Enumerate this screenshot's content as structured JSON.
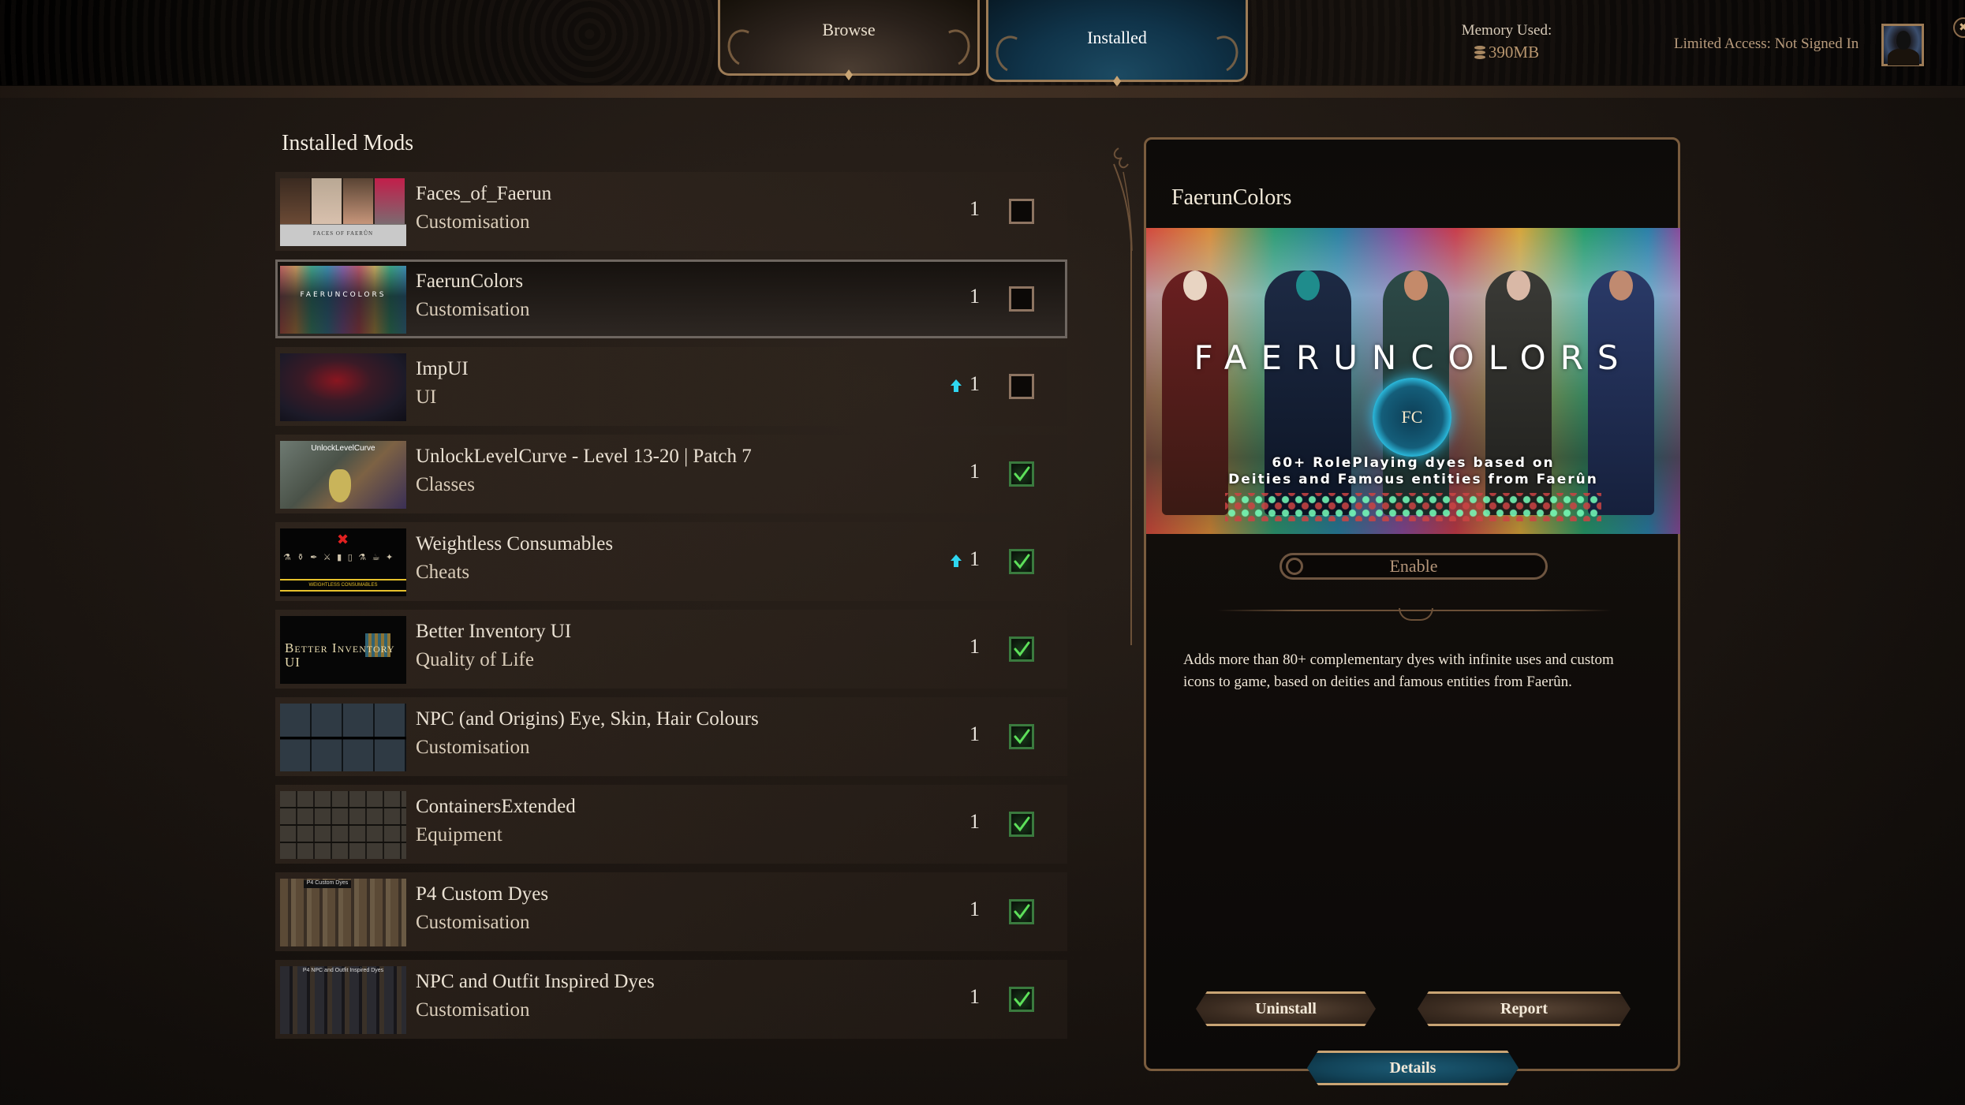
{
  "header": {
    "tabs": [
      {
        "label": "Browse",
        "active": false
      },
      {
        "label": "Installed",
        "active": true
      }
    ],
    "memory_label": "Memory Used:",
    "memory_value": "390MB",
    "account_status": "Limited Access: Not Signed In",
    "icons": {
      "memory": "database-icon",
      "avatar": "user-avatar-icon",
      "close": "close-icon"
    }
  },
  "installed": {
    "title": "Installed Mods",
    "mods": [
      {
        "name": "Faces_of_Faerun",
        "category": "Customisation",
        "version": "1",
        "update_available": false,
        "enabled": false,
        "thumb_caption": "FACES OF FAERÛN",
        "selected": false
      },
      {
        "name": "FaerunColors",
        "category": "Customisation",
        "version": "1",
        "update_available": false,
        "enabled": false,
        "thumb_caption": "FAERUNCOLORS",
        "selected": true
      },
      {
        "name": "ImpUI",
        "category": "UI",
        "version": "1",
        "update_available": true,
        "enabled": false,
        "thumb_caption": "",
        "selected": false
      },
      {
        "name": "UnlockLevelCurve - Level 13-20 | Patch 7",
        "category": "Classes",
        "version": "1",
        "update_available": false,
        "enabled": true,
        "thumb_caption": "UnlockLevelCurve",
        "selected": false
      },
      {
        "name": "Weightless Consumables",
        "category": "Cheats",
        "version": "1",
        "update_available": true,
        "enabled": true,
        "thumb_caption": "WEIGHTLESS CONSUMABLES",
        "selected": false
      },
      {
        "name": "Better Inventory UI",
        "category": "Quality of Life",
        "version": "1",
        "update_available": false,
        "enabled": true,
        "thumb_caption": "Better Inventory UI",
        "selected": false
      },
      {
        "name": "NPC (and Origins) Eye, Skin, Hair Colours",
        "category": "Customisation",
        "version": "1",
        "update_available": false,
        "enabled": true,
        "thumb_caption": "",
        "selected": false
      },
      {
        "name": "ContainersExtended",
        "category": "Equipment",
        "version": "1",
        "update_available": false,
        "enabled": true,
        "thumb_caption": "",
        "selected": false
      },
      {
        "name": "P4 Custom Dyes",
        "category": "Customisation",
        "version": "1",
        "update_available": false,
        "enabled": true,
        "thumb_caption": "P4 Custom Dyes",
        "selected": false
      },
      {
        "name": "NPC and Outfit Inspired Dyes",
        "category": "Customisation",
        "version": "1",
        "update_available": false,
        "enabled": true,
        "thumb_caption": "P4 NPC and Outfit Inspired Dyes",
        "selected": false
      }
    ]
  },
  "detail": {
    "title": "FaerunColors",
    "hero": {
      "title": "FAERUNCOLORS",
      "logo_text": "FC",
      "subtitle_line1": "60+ RolePlaying dyes based on",
      "subtitle_line2": "Deities and Famous entities from Faerûn"
    },
    "enable_label": "Enable",
    "enable_state": false,
    "description": "Adds more than 80+ complementary dyes with infinite uses and custom icons to game, based on deities and famous entities from Faerûn.",
    "buttons": {
      "uninstall": "Uninstall",
      "report": "Report",
      "details": "Details"
    }
  },
  "colors": {
    "accent_gold": "#9c7b56",
    "active_tab_blue": "#10344a",
    "check_green": "#3a7a3e",
    "update_cyan": "#2fd6f0",
    "text_primary": "#eae1d3"
  }
}
